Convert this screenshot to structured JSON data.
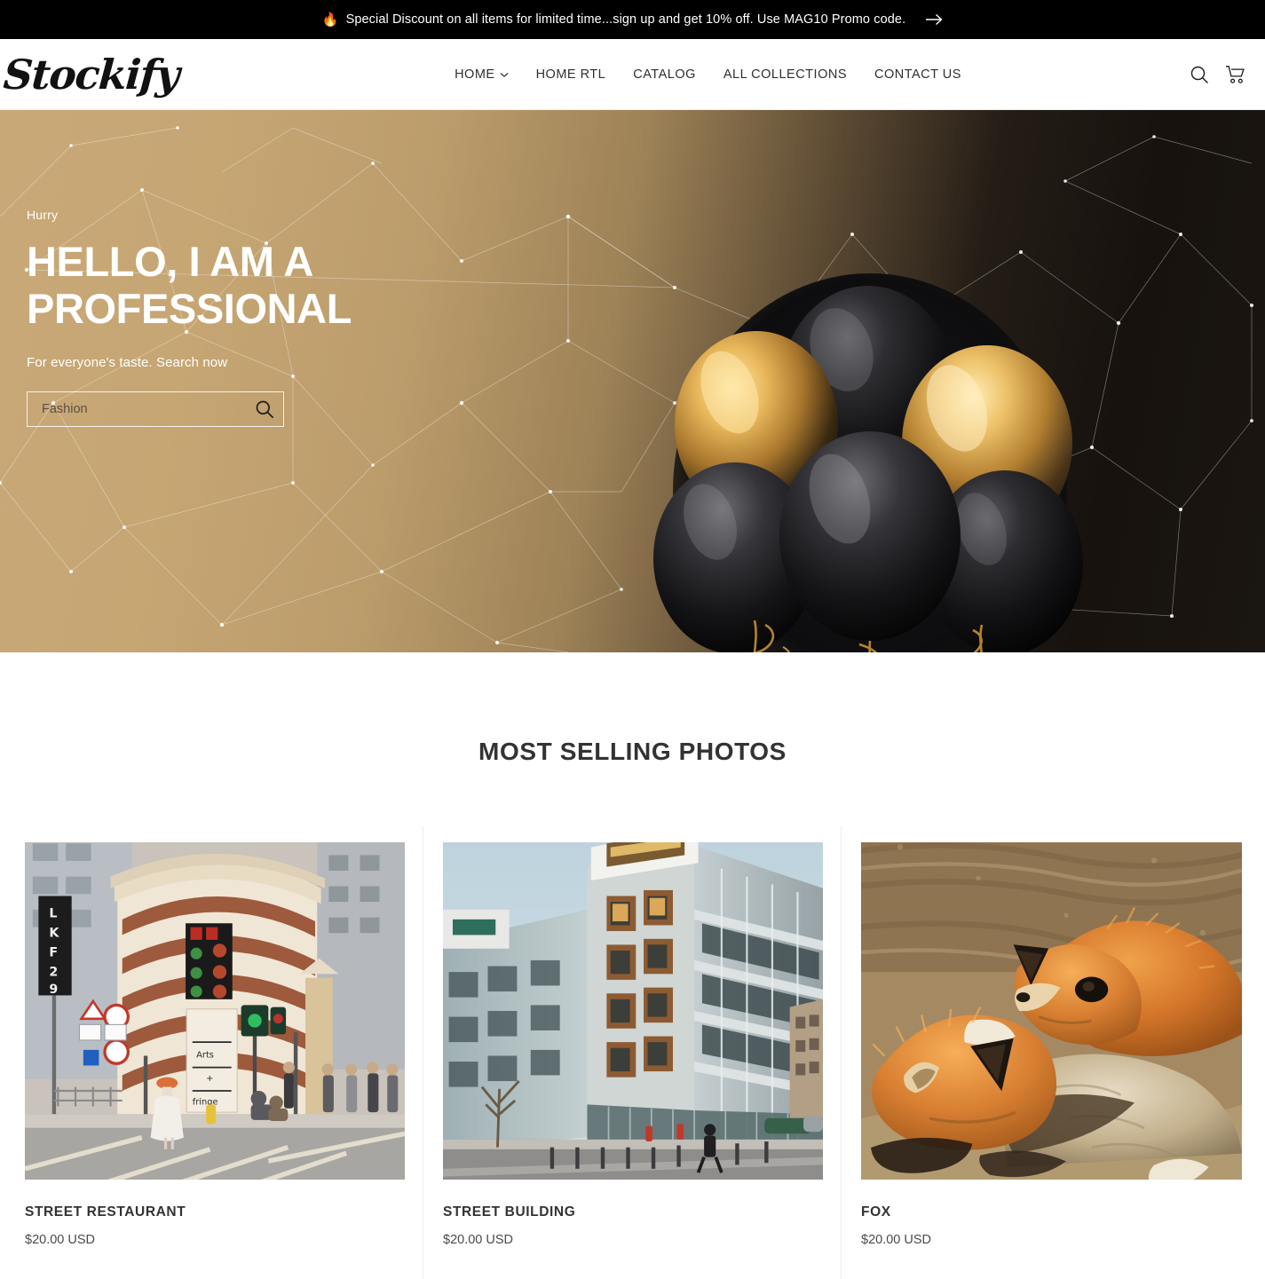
{
  "announcement": {
    "icon": "flame-icon",
    "text": "Special Discount on all items for limited time...sign up and get 10% off. Use MAG10 Promo code.",
    "arrow_icon": "arrow-right-icon"
  },
  "header": {
    "logo": "Stockify",
    "nav": [
      {
        "label": "HOME",
        "has_dropdown": true
      },
      {
        "label": "HOME RTL",
        "has_dropdown": false
      },
      {
        "label": "CATALOG",
        "has_dropdown": false
      },
      {
        "label": "ALL COLLECTIONS",
        "has_dropdown": false
      },
      {
        "label": "CONTACT US",
        "has_dropdown": false
      }
    ],
    "icons": [
      {
        "name": "search-icon"
      },
      {
        "name": "cart-icon"
      }
    ]
  },
  "hero": {
    "kicker": "Hurry",
    "title": "HELLO, I AM A PROFESSIONAL",
    "subtitle": "For everyone's taste. Search now",
    "search": {
      "value": "",
      "placeholder": "Fashion",
      "button_icon": "search-icon"
    },
    "image_alt": "black-and-gold-balloons",
    "colors": {
      "gradient_start": "#c8a877",
      "gradient_end": "#17120e",
      "network_line": "#ffffff"
    }
  },
  "main": {
    "section_title": "MOST SELLING PHOTOS",
    "products": [
      {
        "title": "STREET RESTAURANT",
        "price": "$20.00 USD",
        "image_alt": "corner-brick-building-street-scene"
      },
      {
        "title": "STREET BUILDING",
        "price": "$20.00 USD",
        "image_alt": "modern-apartment-building"
      },
      {
        "title": "FOX",
        "price": "$20.00 USD",
        "image_alt": "two-red-foxes-resting"
      }
    ]
  }
}
